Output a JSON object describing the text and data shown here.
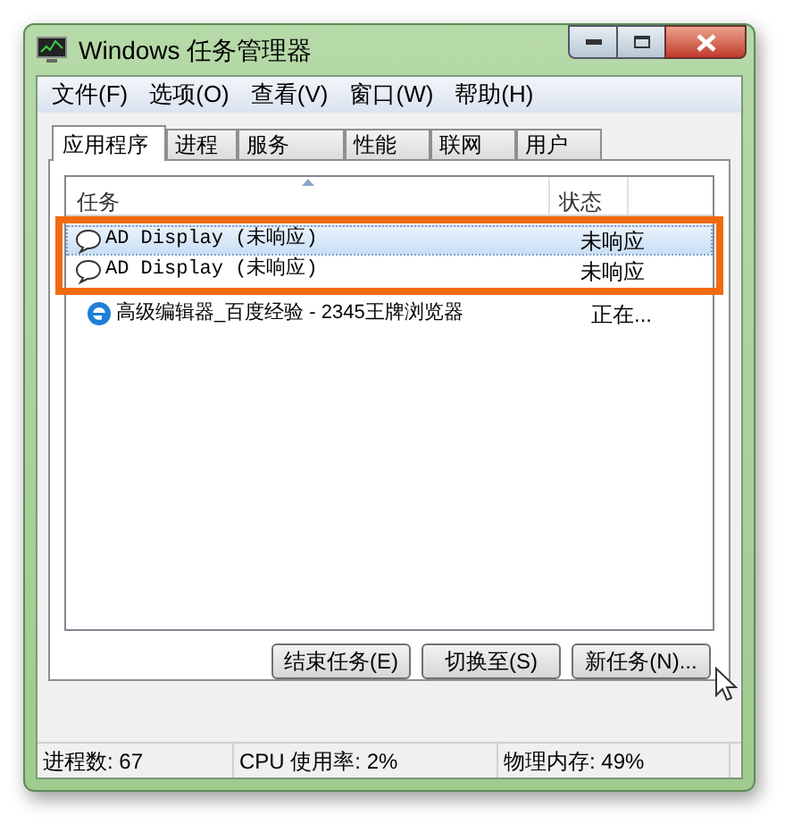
{
  "window": {
    "title": "Windows 任务管理器"
  },
  "menu": [
    "文件(F)",
    "选项(O)",
    "查看(V)",
    "窗口(W)",
    "帮助(H)"
  ],
  "tabs": [
    {
      "label": "应用程序",
      "selected": true
    },
    {
      "label": "进程",
      "selected": false
    },
    {
      "label": "服务",
      "selected": false
    },
    {
      "label": "性能",
      "selected": false
    },
    {
      "label": "联网",
      "selected": false
    },
    {
      "label": "用户",
      "selected": false
    }
  ],
  "table": {
    "columns": [
      "任务",
      "状态"
    ],
    "rows": [
      {
        "kind": "unresponsive",
        "task": "AD Display (未响应)",
        "status": "未响应",
        "selected": true
      },
      {
        "kind": "unresponsive",
        "task": "AD Display (未响应)",
        "status": "未响应",
        "selected": false
      },
      {
        "kind": "browser",
        "task": "高级编辑器_百度经验 - 2345王牌浏览器",
        "status": "正在...",
        "selected": false
      }
    ]
  },
  "buttons": [
    "结束任务(E)",
    "切换至(S)",
    "新任务(N)..."
  ],
  "status_bar": [
    "进程数: 67",
    "CPU 使用率: 2%",
    "物理内存: 49%"
  ]
}
